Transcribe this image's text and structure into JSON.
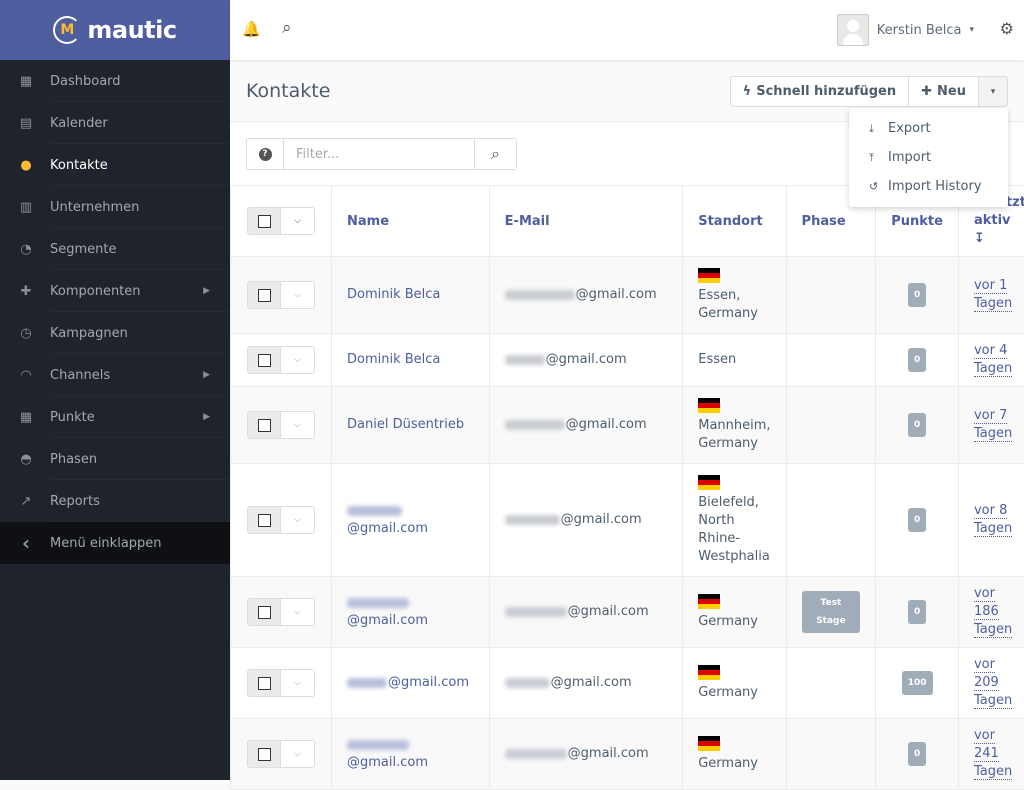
{
  "brand": {
    "name": "mautic",
    "logo_mark": "M"
  },
  "sidebar": {
    "items": [
      {
        "label": "Dashboard",
        "icon": "▦",
        "name": "dashboard",
        "has_submenu": false,
        "active": false
      },
      {
        "label": "Kalender",
        "icon": "▤",
        "name": "calendar",
        "has_submenu": false,
        "active": false
      },
      {
        "label": "Kontakte",
        "icon": "●",
        "name": "contacts",
        "has_submenu": false,
        "active": true
      },
      {
        "label": "Unternehmen",
        "icon": "▥",
        "name": "companies",
        "has_submenu": false,
        "active": false
      },
      {
        "label": "Segmente",
        "icon": "◔",
        "name": "segments",
        "has_submenu": false,
        "active": false
      },
      {
        "label": "Komponenten",
        "icon": "✚",
        "name": "components",
        "has_submenu": true,
        "active": false
      },
      {
        "label": "Kampagnen",
        "icon": "◷",
        "name": "campaigns",
        "has_submenu": false,
        "active": false
      },
      {
        "label": "Channels",
        "icon": "◠",
        "name": "channels",
        "has_submenu": true,
        "active": false
      },
      {
        "label": "Punkte",
        "icon": "▦",
        "name": "points",
        "has_submenu": true,
        "active": false
      },
      {
        "label": "Phasen",
        "icon": "◓",
        "name": "stages",
        "has_submenu": false,
        "active": false
      },
      {
        "label": "Reports",
        "icon": "↗",
        "name": "reports",
        "has_submenu": false,
        "active": false
      }
    ],
    "collapse_label": "Menü einklappen",
    "collapse_icon": "‹"
  },
  "topbar": {
    "bell_icon": "🔔",
    "search_icon": "⌕",
    "user_name": "Kerstin Belca",
    "user_caret": "▾",
    "gear_icon": "⚙"
  },
  "page": {
    "title": "Kontakte",
    "buttons": {
      "quick_add": "Schnell hinzufügen",
      "quick_add_icon": "ϟ",
      "new": "Neu",
      "new_icon": "✚",
      "more_icon": "▾"
    },
    "dropdown": [
      {
        "label": "Export",
        "icon": "⤓"
      },
      {
        "label": "Import",
        "icon": "⤒"
      },
      {
        "label": "Import History",
        "icon": "↺"
      }
    ],
    "filter": {
      "placeholder": "Filter...",
      "help_icon": "?",
      "search_icon": "⌕"
    }
  },
  "table": {
    "columns": [
      "Name",
      "E-Mail",
      "Standort",
      "Phase",
      "Punkte",
      "Zuletzt aktiv"
    ],
    "rows": [
      {
        "name": "Dominik Belca",
        "name_blur": 0,
        "email": "@gmail.com",
        "email_blur": 70,
        "flag": true,
        "location": "Essen, Germany",
        "phase": "",
        "points": "0",
        "last_active": "vor 1 Tagen"
      },
      {
        "name": "Dominik Belca",
        "name_blur": 0,
        "email": "@gmail.com",
        "email_blur": 40,
        "flag": false,
        "location": "Essen",
        "phase": "",
        "points": "0",
        "last_active": "vor 4 Tagen"
      },
      {
        "name": "Daniel Düsentrieb",
        "name_blur": 0,
        "email": "@gmail.com",
        "email_blur": 60,
        "flag": true,
        "location": "Mannheim, Germany",
        "phase": "",
        "points": "0",
        "last_active": "vor 7 Tagen"
      },
      {
        "name": "@gmail.com",
        "name_blur": 55,
        "email": "@gmail.com",
        "email_blur": 55,
        "flag": true,
        "location": "Bielefeld, North Rhine-Westphalia",
        "phase": "",
        "points": "0",
        "last_active": "vor 8 Tagen"
      },
      {
        "name": "@gmail.com",
        "name_blur": 62,
        "email": "@gmail.com",
        "email_blur": 62,
        "flag": true,
        "location": "Germany",
        "phase": "Test Stage",
        "points": "0",
        "last_active": "vor 186 Tagen"
      },
      {
        "name": "@gmail.com",
        "name_blur": 40,
        "email": "@gmail.com",
        "email_blur": 45,
        "flag": true,
        "location": "Germany",
        "phase": "",
        "points": "100",
        "last_active": "vor 209 Tagen"
      },
      {
        "name": "@gmail.com",
        "name_blur": 62,
        "email": "@gmail.com",
        "email_blur": 62,
        "flag": true,
        "location": "Germany",
        "phase": "",
        "points": "0",
        "last_active": "vor 241 Tagen"
      }
    ]
  },
  "colors": {
    "brand": "#4e5e9e",
    "sidebar_bg": "#1f232b",
    "accent": "#fdb933",
    "badge": "#a0acb8"
  }
}
